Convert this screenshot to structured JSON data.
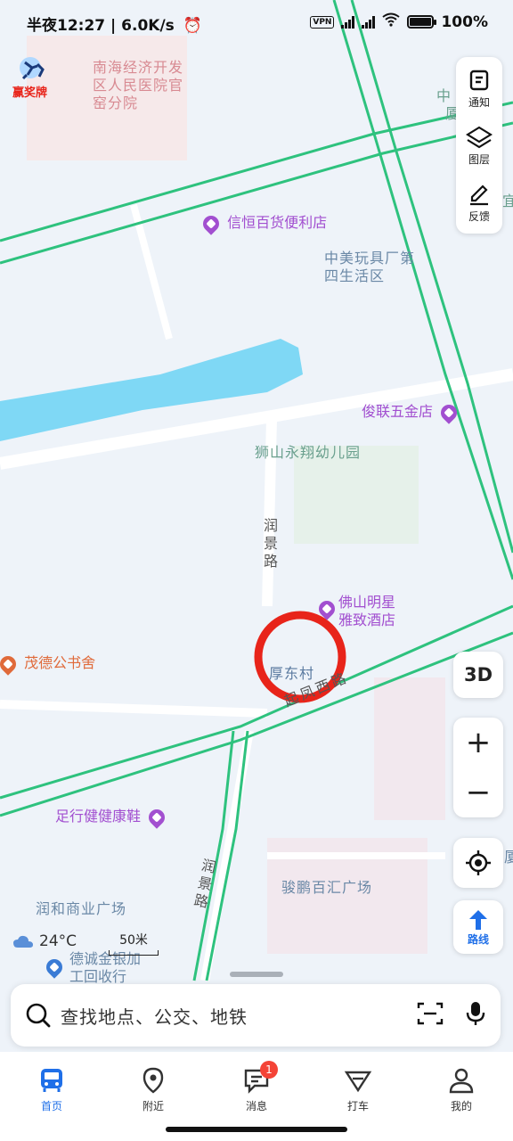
{
  "status_bar": {
    "time_label": "半夜12:27 | 6.0K/s",
    "vpn": "VPN",
    "battery": "100%"
  },
  "map": {
    "pois": {
      "hospital": "南海经济开发区人民医院官窑分院",
      "store": "信恒百货便利店",
      "toy_factory": "中美玩具厂第四生活区",
      "hardware": "俊联五金店",
      "kindergarten": "狮山永翔幼儿园",
      "road_runjing": "润景路",
      "hotel": "佛山明星雅致酒店",
      "bookhouse": "茂德公书舍",
      "village": "厚东村",
      "road_qifeng": "起凤西路",
      "shoe": "足行健健康鞋",
      "plaza_runhe": "润和商业广场",
      "road_runjing2": "润景路",
      "plaza_junpeng": "骏鹏百汇广场",
      "jewelry": "德诚金银加工回收行",
      "edge_top": "中",
      "edge_top2": "厦",
      "edge_right": "宜",
      "edge_right2": "厦"
    },
    "brand_logo": "赢奖牌"
  },
  "tools": {
    "notify_label": "通知",
    "layers_label": "图层",
    "feedback_label": "反馈",
    "three_d_label": "3D",
    "zoom_in": "+",
    "zoom_out": "−",
    "route_label": "路线"
  },
  "weather": {
    "temp": "24°C"
  },
  "scale": {
    "label": "50米"
  },
  "search": {
    "placeholder": "查找地点、公交、地铁"
  },
  "nav": {
    "items": [
      {
        "label": "首页"
      },
      {
        "label": "附近"
      },
      {
        "label": "消息"
      },
      {
        "label": "打车"
      },
      {
        "label": "我的"
      }
    ],
    "message_badge": "1"
  },
  "colors": {
    "accent": "#1f6fe8",
    "road_green": "#2ec27e",
    "water": "#7fd8f5",
    "marker_red": "#e8241a"
  }
}
